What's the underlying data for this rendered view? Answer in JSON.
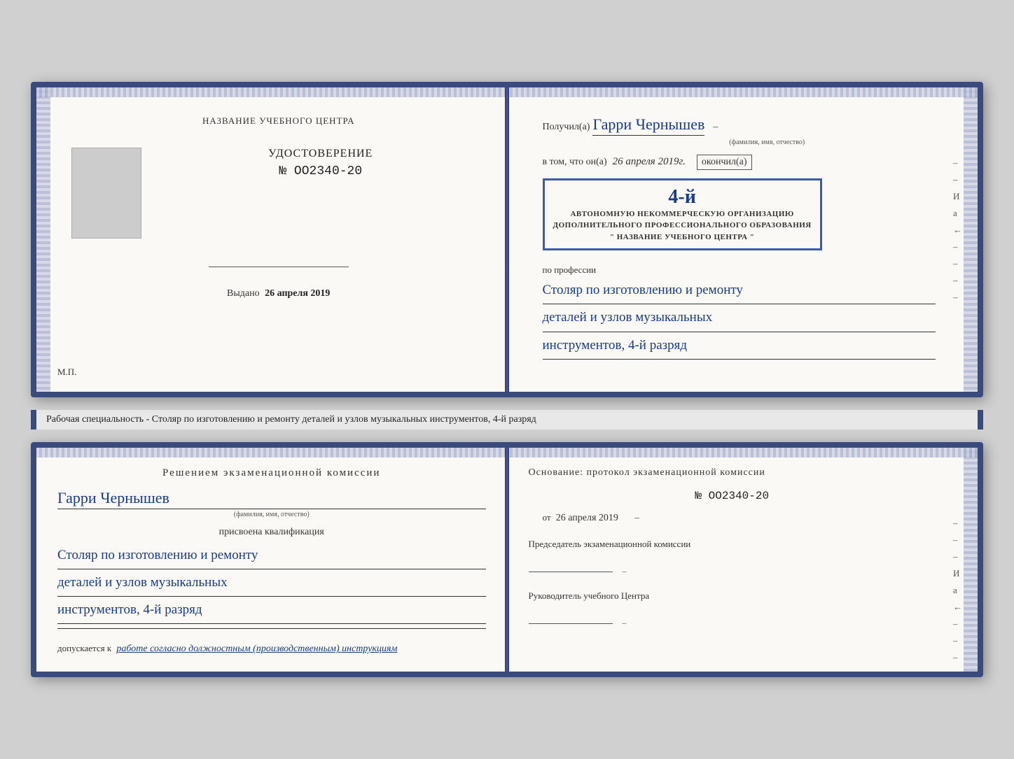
{
  "page": {
    "background": "#d0d0d0"
  },
  "top_spread": {
    "left_page": {
      "title": "НАЗВАНИЕ УЧЕБНОГО ЦЕНТРА",
      "cert_label": "УДОСТОВЕРЕНИЕ",
      "cert_number": "№ OO2340-20",
      "issued_label": "Выдано",
      "issued_date": "26 апреля 2019",
      "mp_label": "М.П."
    },
    "right_page": {
      "poluchil_label": "Получил(а)",
      "recipient_name": "Гарри Чернышев",
      "fio_label": "(фамилия, имя, отчество)",
      "vtom_label": "в том, что он(а)",
      "date_value": "26 апреля 2019г.",
      "okonchil_label": "окончил(а)",
      "stamp_number": "4-й",
      "stamp_line1": "АВТОНОМНУЮ НЕКОММЕРЧЕСКУЮ ОРГАНИЗАЦИЮ",
      "stamp_line2": "ДОПОЛНИТЕЛЬНОГО ПРОФЕССИОНАЛЬНОГО ОБРАЗОВАНИЯ",
      "stamp_line3": "\" НАЗВАНИЕ УЧЕБНОГО ЦЕНТРА \"",
      "po_professii_label": "по профессии",
      "profession_line1": "Столяр по изготовлению и ремонту",
      "profession_line2": "деталей и узлов музыкальных",
      "profession_line3": "инструментов, 4-й разряд"
    }
  },
  "description_bar": {
    "text": "Рабочая специальность - Столяр по изготовлению и ремонту деталей и узлов музыкальных инструментов, 4-й разряд"
  },
  "bottom_spread": {
    "left_page": {
      "resheniye_label": "Решением  экзаменационной  комиссии",
      "fio_name": "Гарри Чернышев",
      "fio_sub_label": "(фамилия, имя, отчество)",
      "prisvoena_label": "присвоена квалификация",
      "qualification_line1": "Столяр по изготовлению и ремонту",
      "qualification_line2": "деталей и узлов музыкальных",
      "qualification_line3": "инструментов, 4-й разряд",
      "dopuskaetsya_label": "допускается к",
      "dopusk_value": "работе согласно должностным (производственным) инструкциям"
    },
    "right_page": {
      "osnovaniye_label": "Основание: протокол экзаменационной  комиссии",
      "number_label": "№  OO2340-20",
      "ot_label": "от",
      "ot_date": "26 апреля 2019",
      "predsedatel_label": "Председатель экзаменационной комиссии",
      "rukovoditel_label": "Руководитель учебного Центра",
      "right_letters_i": "И",
      "right_letters_a": "а",
      "right_letters_arrow": "←"
    }
  }
}
